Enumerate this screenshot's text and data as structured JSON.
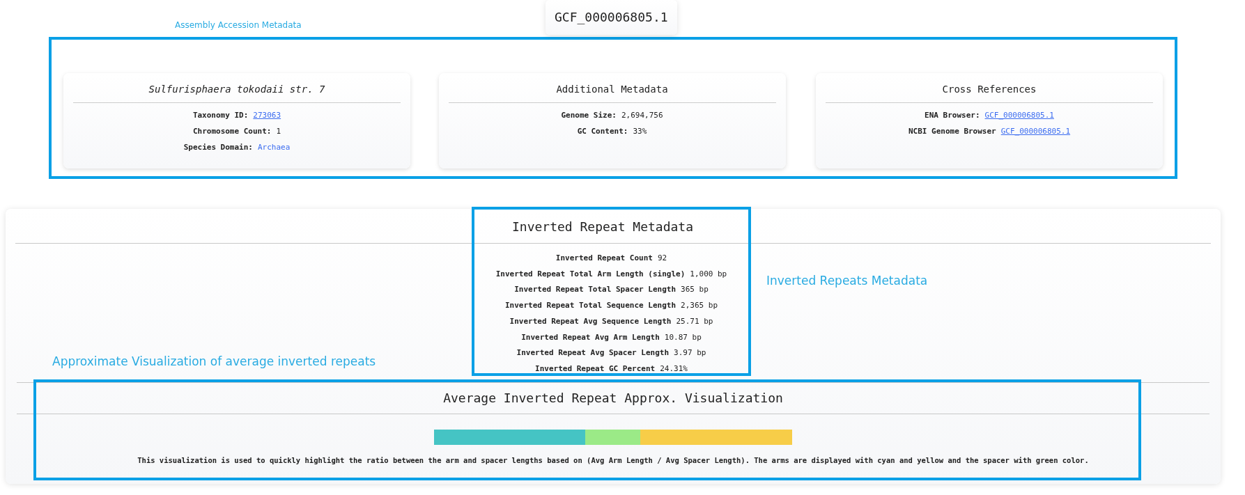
{
  "assembly": {
    "annotation_label": "Assembly Accession Metadata",
    "accession": "GCF_000006805.1",
    "cards": [
      {
        "title": "Sulfurisphaera tokodaii str. 7",
        "italic": true,
        "rows": [
          {
            "label": "Taxonomy ID:",
            "value": "273063",
            "kind": "link"
          },
          {
            "label": "Chromosome Count:",
            "value": "1",
            "kind": "plain"
          },
          {
            "label": "Species Domain:",
            "value": "Archaea",
            "kind": "accent"
          }
        ]
      },
      {
        "title": "Additional Metadata",
        "italic": false,
        "rows": [
          {
            "label": "Genome Size:",
            "value": "2,694,756",
            "kind": "plain"
          },
          {
            "label": "GC Content:",
            "value": "33%",
            "kind": "plain"
          }
        ]
      },
      {
        "title": "Cross References",
        "italic": false,
        "rows": [
          {
            "label": "ENA Browser:",
            "value": "GCF_000006805.1",
            "kind": "link"
          },
          {
            "label": "NCBI Genome Browser",
            "value": "GCF_000006805.1",
            "kind": "link"
          }
        ]
      }
    ]
  },
  "inverted_repeats": {
    "title": "Inverted Repeat Metadata",
    "annotation_label": "Inverted Repeats Metadata",
    "rows": [
      {
        "label": "Inverted Repeat Count",
        "value": "92"
      },
      {
        "label": "Inverted Repeat Total Arm Length (single)",
        "value": "1,000 bp"
      },
      {
        "label": "Inverted Repeat Total Spacer Length",
        "value": "365 bp"
      },
      {
        "label": "Inverted Repeat Total Sequence Length",
        "value": "2,365 bp"
      },
      {
        "label": "Inverted Repeat Avg Sequence Length",
        "value": "25.71 bp"
      },
      {
        "label": "Inverted Repeat Avg Arm Length",
        "value": "10.87 bp"
      },
      {
        "label": "Inverted Repeat Avg Spacer Length",
        "value": "3.97 bp"
      },
      {
        "label": "Inverted Repeat GC Percent",
        "value": "24.31%"
      }
    ]
  },
  "visualization": {
    "annotation_label": "Approximate Visualization of average inverted repeats",
    "title": "Average Inverted Repeat Approx. Visualization",
    "segments": [
      {
        "color": "#45c4c4"
      },
      {
        "color": "#9bea87"
      },
      {
        "color": "#f7cd48"
      }
    ],
    "description": "This visualization is used to quickly highlight the ratio between the arm and spacer lengths based on (Avg Arm Length / Avg Spacer Length). The arms are displayed with cyan and yellow and the spacer with green color."
  }
}
